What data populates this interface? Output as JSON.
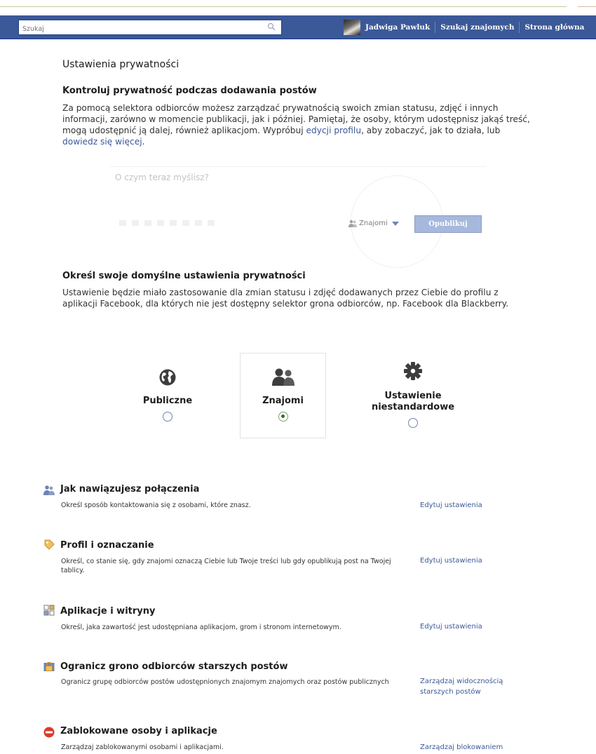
{
  "header": {
    "search_placeholder": "Szukaj",
    "user_name": "Jadwiga Pawluk",
    "nav_find_friends": "Szukaj znajomych",
    "nav_home": "Strona główna"
  },
  "page_title": "Ustawienia prywatności",
  "control_section": {
    "title": "Kontroluj prywatność podczas dodawania postów",
    "text_1": "Za pomocą selektora odbiorców możesz zarządzać prywatnością swoich zmian statusu, zdjęć i innych informacji, zarówno w momencie publikacji, jak i później. Pamiętaj, że osoby, którym udostępnisz jakąś treść, mogą udostępnić ją dalej, również aplikacjom. Wypróbuj ",
    "link_edit_profile": "edycji profilu",
    "text_2": ", aby zobaczyć, jak to działa, lub ",
    "link_learn_more": "dowiedz się więcej",
    "text_3": "."
  },
  "composer": {
    "placeholder": "O czym teraz myślisz?",
    "audience": "Znajomi",
    "publish": "Opublikuj"
  },
  "default_section": {
    "title": "Określ swoje domyślne ustawienia prywatności",
    "text": "Ustawienie będzie miało zastosowanie dla zmian statusu i zdjęć dodawanych przez Ciebie do profilu z aplikacji Facebook, dla których nie jest dostępny selektor grona odbiorców, np. Facebook dla Blackberry."
  },
  "options": {
    "public": "Publiczne",
    "friends": "Znajomi",
    "custom_1": "Ustawienie",
    "custom_2": "niestandardowe",
    "selected": "friends"
  },
  "settings": [
    {
      "title": "Jak nawiązujesz połączenia",
      "desc": "Określ sposób kontaktowania się z osobami, które znasz.",
      "link": "Edytuj ustawienia",
      "icon": "people-icon"
    },
    {
      "title": "Profil i oznaczanie",
      "desc": "Określ, co stanie się, gdy znajomi oznaczą Ciebie lub Twoje treści lub gdy opublikują post na Twojej tablicy.",
      "link": "Edytuj ustawienia",
      "icon": "tag-icon"
    },
    {
      "title": "Aplikacje i witryny",
      "desc": "Określ, jaka zawartość jest udostępniana aplikacjom, grom i stronom internetowym.",
      "link": "Edytuj ustawienia",
      "icon": "apps-icon"
    },
    {
      "title": "Ogranicz grono odbiorców starszych postów",
      "desc": "Ogranicz grupę odbiorców postów udostępnionych znajomym znajomych oraz postów publicznych",
      "link": "Zarządzaj widocznością starszych postów",
      "icon": "lock-icon"
    },
    {
      "title": "Zablokowane osoby i aplikacje",
      "desc": "Zarządzaj zablokowanymi osobami i aplikacjami.",
      "link": "Zarządzaj blokowaniem",
      "icon": "block-icon"
    }
  ],
  "colors": {
    "brand_blue": "#3b5998",
    "link": "#3b5998",
    "radio_selected": "#3b6b2b"
  }
}
